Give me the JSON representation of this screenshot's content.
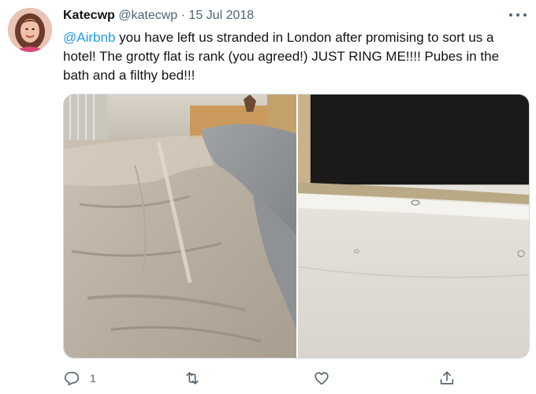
{
  "tweet": {
    "display_name": "Katecwp",
    "handle": "@katecwp",
    "separator": "·",
    "date": "15 Jul 2018",
    "mention": "@Airbnb",
    "body": " you have left us stranded in London after promising to sort us a hotel! The grotty flat is rank (you agreed!) JUST RING ME!!!! Pubes in the bath and a filthy bed!!!",
    "reply_count": "1",
    "retweet_count": "",
    "like_count": ""
  },
  "icons": {
    "more": "more-dots-icon",
    "reply": "reply-bubble-icon",
    "retweet": "retweet-arrows-icon",
    "like": "heart-icon",
    "share": "share-upload-icon"
  },
  "colors": {
    "link": "#1d9bf0",
    "muted": "#536471",
    "text": "#0f1419",
    "border": "#cfd9de"
  }
}
